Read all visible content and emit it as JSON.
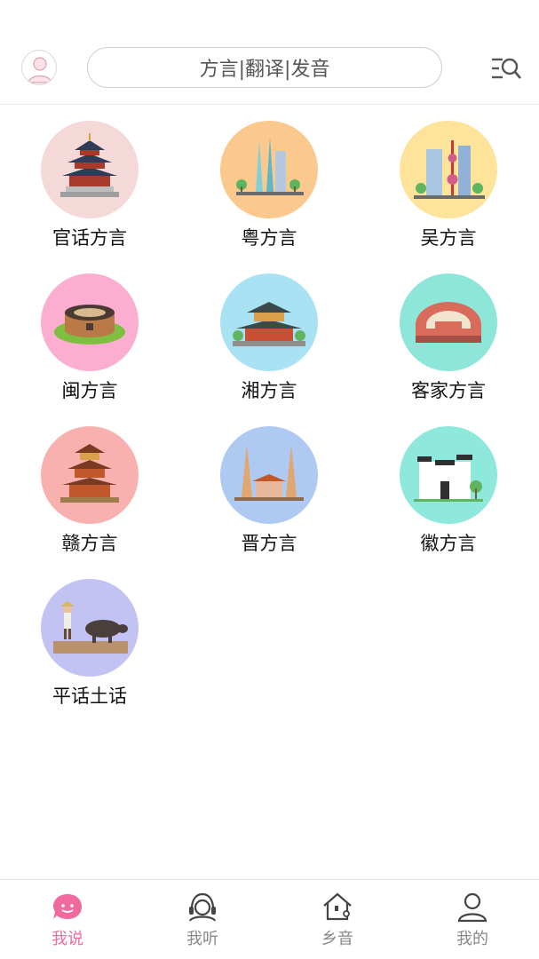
{
  "search": {
    "placeholder": "方言|翻译|发音"
  },
  "dialects": [
    {
      "label": "官话方言",
      "bg": "#f5d9d8",
      "icon": "temple-of-heaven-icon"
    },
    {
      "label": "粤方言",
      "bg": "#fbc98e",
      "icon": "canton-tower-icon"
    },
    {
      "label": "吴方言",
      "bg": "#fde49a",
      "icon": "shanghai-skyline-icon"
    },
    {
      "label": "闽方言",
      "bg": "#fcaed0",
      "icon": "tulou-icon"
    },
    {
      "label": "湘方言",
      "bg": "#a9e2f3",
      "icon": "yueyang-tower-icon"
    },
    {
      "label": "客家方言",
      "bg": "#8ee6d9",
      "icon": "hakka-walled-house-icon"
    },
    {
      "label": "赣方言",
      "bg": "#f9b1b0",
      "icon": "tengwang-pavilion-icon"
    },
    {
      "label": "晋方言",
      "bg": "#aec9f2",
      "icon": "twin-pagodas-icon"
    },
    {
      "label": "徽方言",
      "bg": "#8fe8dc",
      "icon": "huizhou-architecture-icon"
    },
    {
      "label": "平话土话",
      "bg": "#c3c3f3",
      "icon": "farmer-buffalo-icon"
    }
  ],
  "tabs": [
    {
      "label": "我说",
      "active": true,
      "icon": "speech-bubble-icon"
    },
    {
      "label": "我听",
      "active": false,
      "icon": "headset-icon"
    },
    {
      "label": "乡音",
      "active": false,
      "icon": "home-icon"
    },
    {
      "label": "我的",
      "active": false,
      "icon": "user-icon"
    }
  ],
  "colors": {
    "accent": "#f06aa0",
    "tab_inactive": "#888888"
  }
}
